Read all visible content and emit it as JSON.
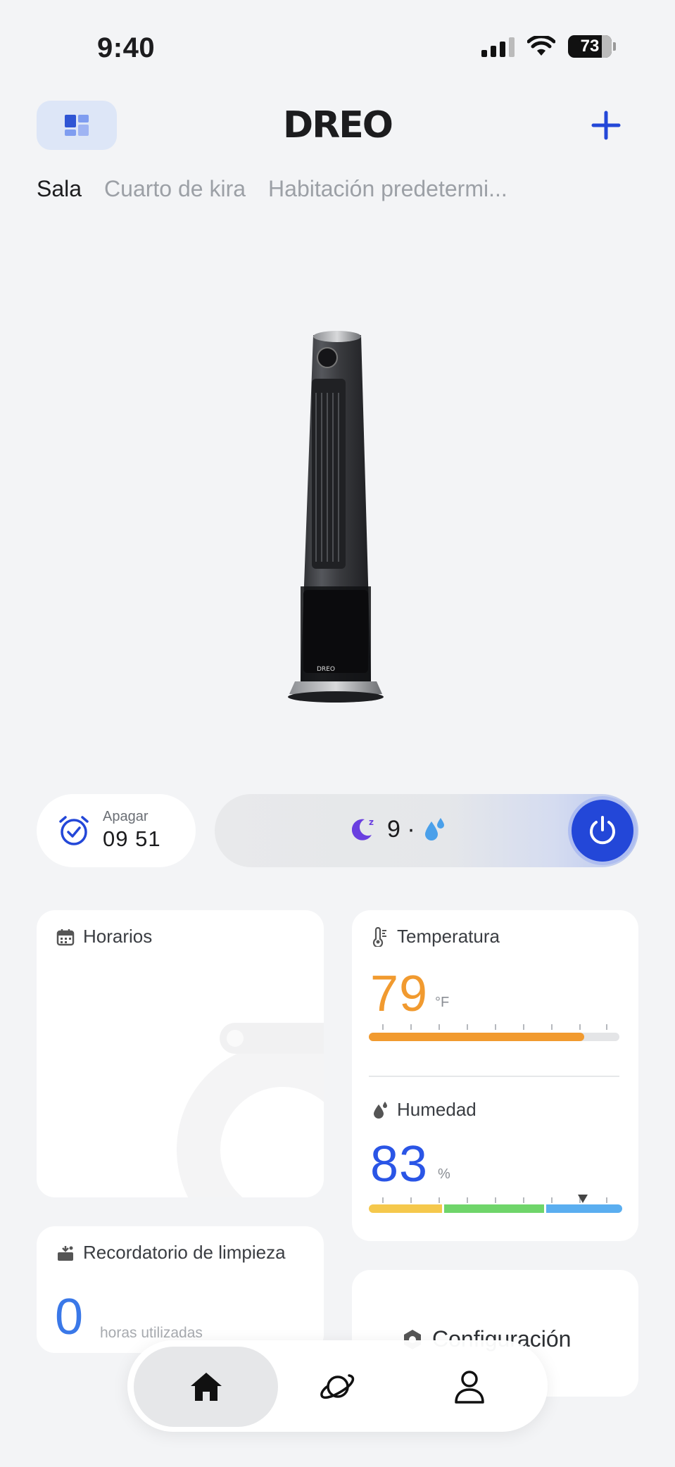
{
  "status_bar": {
    "time": "9:40",
    "battery": "73",
    "icons": [
      "signal-icon",
      "wifi-icon",
      "battery-icon"
    ]
  },
  "header": {
    "logo": "DREO",
    "layout_icon": "layout-grid-icon",
    "add_icon": "plus-icon",
    "accent_color": "#2347d8"
  },
  "rooms": {
    "tabs": [
      "Sala",
      "Cuarto de kira",
      "Habitación predetermi..."
    ],
    "active": 0
  },
  "controls": {
    "timer": {
      "label": "Apagar",
      "value": "09 51",
      "icon": "alarm-clock-icon"
    },
    "mode": {
      "sleep_icon": "moon-sleep-icon",
      "speed": "9 ·",
      "humidify_icon": "water-drop-icon"
    },
    "power_icon": "power-icon"
  },
  "cards": {
    "schedule": {
      "title": "Horarios",
      "icon": "calendar-icon"
    },
    "temperature": {
      "title": "Temperatura",
      "icon": "thermometer-icon",
      "value": "79",
      "unit": "°F",
      "level": 0.86,
      "color": "#f19a2f"
    },
    "humidity": {
      "title": "Humedad",
      "icon": "humidity-drop-icon",
      "value": "83",
      "unit": "%",
      "marker": 0.845,
      "color": "#2a55e6",
      "segment_colors": [
        "#f5c84c",
        "#6fd56a",
        "#5aaef0"
      ]
    },
    "cleaning": {
      "title": "Recordatorio de limpieza",
      "icon": "cleaning-icon",
      "value": "0",
      "unit": "horas utilizadas",
      "color": "#3a78e8"
    },
    "config": {
      "title": "Configuración",
      "icon": "hexagon-settings-icon"
    }
  },
  "bottom_nav": {
    "items": [
      "home-icon",
      "planet-icon",
      "profile-icon"
    ],
    "active": 0
  }
}
